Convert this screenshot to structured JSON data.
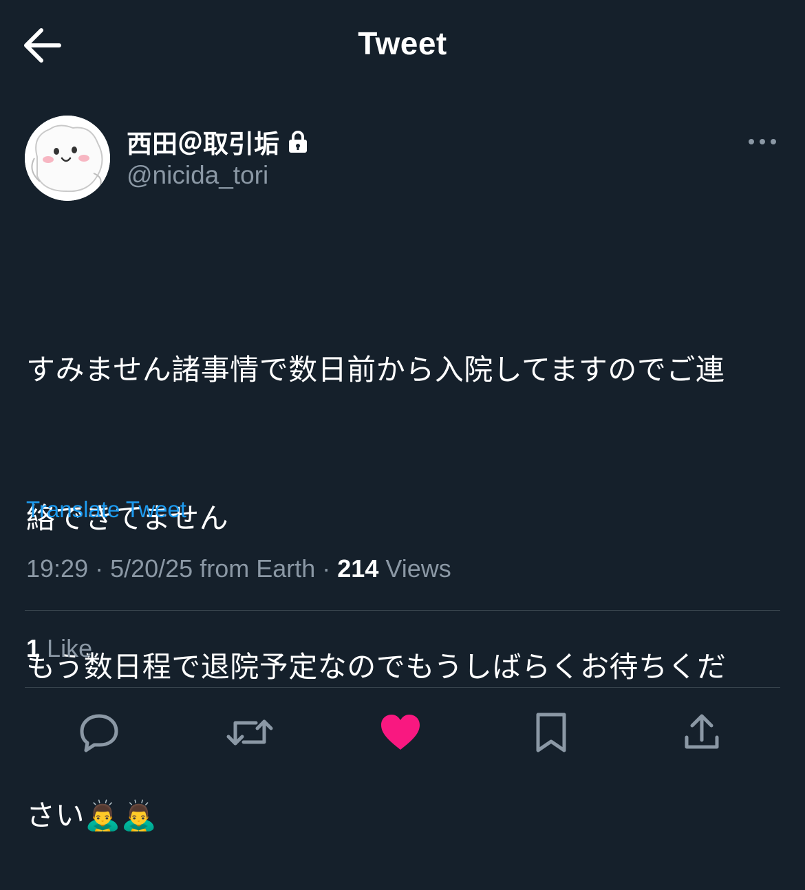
{
  "header": {
    "title": "Tweet",
    "back_icon": "arrow-left-icon"
  },
  "author": {
    "display_name": "西田＠取引垢",
    "handle": "@nicida_tori",
    "protected_icon": "lock-icon",
    "avatar": "white-cat-avatar"
  },
  "tweet": {
    "lines": [
      "すみません諸事情で数日前から入院してますのでご連",
      "絡できてません",
      "もう数日程で退院予定なのでもうしばらくお待ちくだ",
      "さい🙇‍♂️🙇‍♂️"
    ],
    "translate_label": "Translate Tweet",
    "time": "19:29",
    "date": "5/20/25",
    "source": "from Earth",
    "views_count": "214",
    "views_label": "Views",
    "likes_count": "1",
    "likes_label": "Like"
  },
  "actions": {
    "reply": "reply-icon",
    "retweet": "retweet-icon",
    "like": "heart-icon",
    "bookmark": "bookmark-icon",
    "share": "share-icon"
  },
  "colors": {
    "background": "#15202b",
    "accent": "#1d9bf0",
    "like": "#f91880",
    "muted": "#8b98a5"
  }
}
